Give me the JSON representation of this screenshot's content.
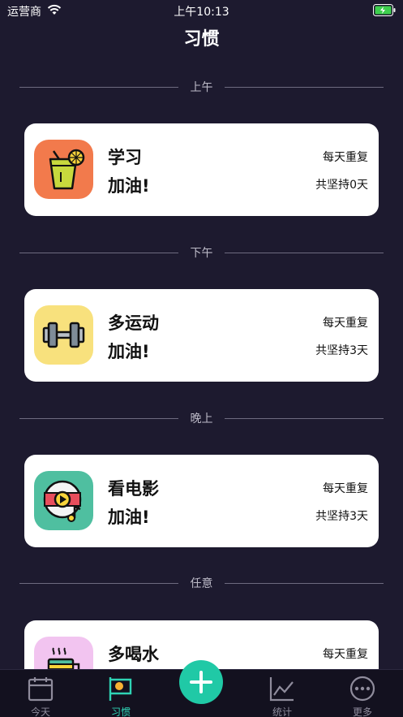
{
  "status": {
    "carrier": "运营商",
    "time": "上午10:13"
  },
  "header": {
    "title": "习惯"
  },
  "sections": [
    {
      "label": "上午",
      "habit": {
        "name": "学习",
        "cheer": "加油!",
        "repeat": "每天重复",
        "streak": "共坚持0天",
        "icon": "juice-icon",
        "color": "#f27a4c"
      }
    },
    {
      "label": "下午",
      "habit": {
        "name": "多运动",
        "cheer": "加油!",
        "repeat": "每天重复",
        "streak": "共坚持3天",
        "icon": "dumbbell-icon",
        "color": "#f8e17d"
      }
    },
    {
      "label": "晚上",
      "habit": {
        "name": "看电影",
        "cheer": "加油!",
        "repeat": "每天重复",
        "streak": "共坚持3天",
        "icon": "film-reel-icon",
        "color": "#4fbfa0"
      }
    },
    {
      "label": "任意",
      "habit": {
        "name": "多喝水",
        "cheer": "",
        "repeat": "每天重复",
        "streak": "",
        "icon": "cup-icon",
        "color": "#f2c4f0"
      }
    }
  ],
  "tabs": [
    {
      "label": "今天",
      "icon": "calendar-icon",
      "active": false
    },
    {
      "label": "习惯",
      "icon": "flag-icon",
      "active": true
    },
    {
      "label": "统计",
      "icon": "chart-icon",
      "active": false
    },
    {
      "label": "更多",
      "icon": "more-icon",
      "active": false
    }
  ],
  "colors": {
    "background": "#1d1a2f",
    "accent": "#20c9a6"
  }
}
